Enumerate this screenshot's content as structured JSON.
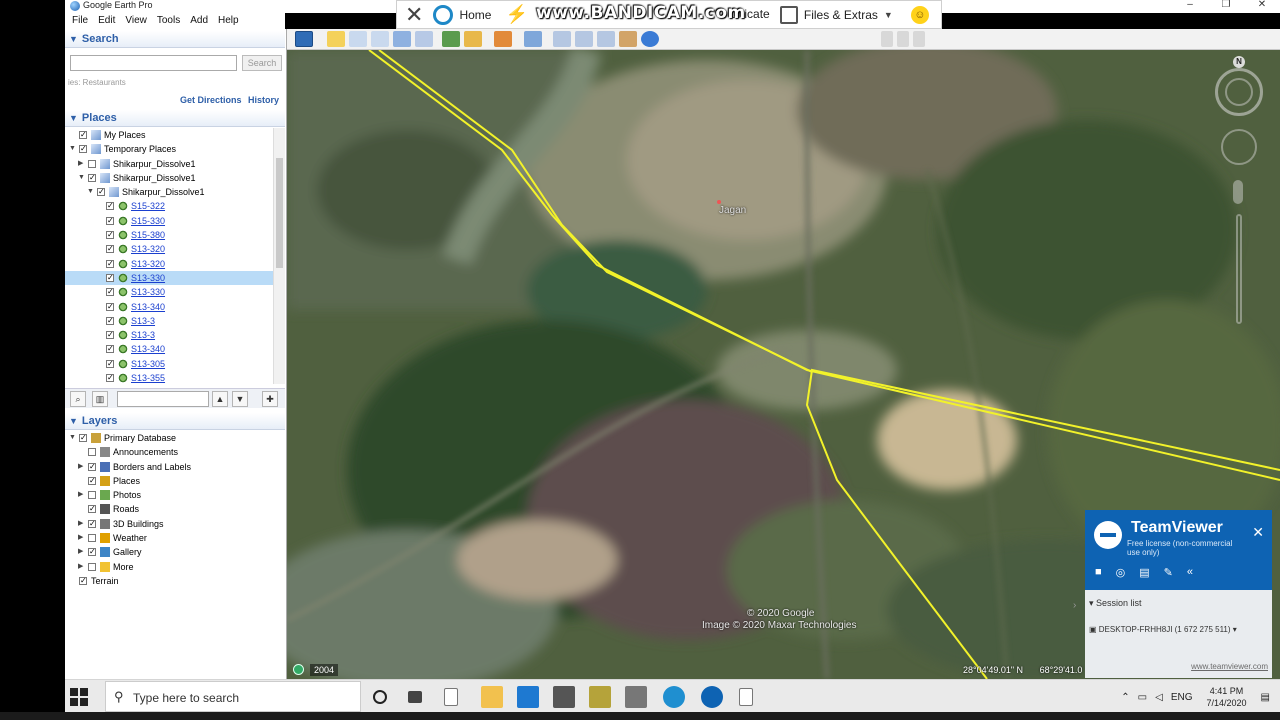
{
  "window": {
    "title": "Google Earth Pro",
    "controls": [
      "–",
      "❐",
      "✕"
    ]
  },
  "menubar": [
    "File",
    "Edit",
    "View",
    "Tools",
    "Add",
    "Help"
  ],
  "teamviewer_toolbar": {
    "home": "Home",
    "communicate": "unicate",
    "files": "Files & Extras"
  },
  "watermark": "www.BANDICAM.com",
  "search": {
    "title": "Search",
    "placeholder": "",
    "button": "Search",
    "hint": "ies: Restaurants",
    "get_directions": "Get Directions",
    "history": "History"
  },
  "places": {
    "title": "Places",
    "items": [
      {
        "label": "My Places",
        "indent": 0,
        "checked": true,
        "expander": "",
        "link": false
      },
      {
        "label": "Temporary Places",
        "indent": 0,
        "checked": true,
        "expander": "▼",
        "link": false
      },
      {
        "label": "Shikarpur_Dissolve1",
        "indent": 1,
        "checked": false,
        "expander": "▶",
        "link": false
      },
      {
        "label": "Shikarpur_Dissolve1",
        "indent": 1,
        "checked": true,
        "expander": "▼",
        "link": false
      },
      {
        "label": "Shikarpur_Dissolve1",
        "indent": 2,
        "checked": true,
        "expander": "▼",
        "link": false
      },
      {
        "label": "S15-322",
        "indent": 3,
        "checked": true,
        "expander": "",
        "link": true
      },
      {
        "label": "S15-330",
        "indent": 3,
        "checked": true,
        "expander": "",
        "link": true
      },
      {
        "label": "S15-380",
        "indent": 3,
        "checked": true,
        "expander": "",
        "link": true
      },
      {
        "label": "S13-320",
        "indent": 3,
        "checked": true,
        "expander": "",
        "link": true
      },
      {
        "label": "S13-320",
        "indent": 3,
        "checked": true,
        "expander": "",
        "link": true
      },
      {
        "label": "S13-330",
        "indent": 3,
        "checked": true,
        "expander": "",
        "link": true,
        "selected": true
      },
      {
        "label": "S13-330",
        "indent": 3,
        "checked": true,
        "expander": "",
        "link": true
      },
      {
        "label": "S13-340",
        "indent": 3,
        "checked": true,
        "expander": "",
        "link": true
      },
      {
        "label": "S13-3",
        "indent": 3,
        "checked": true,
        "expander": "",
        "link": true
      },
      {
        "label": "S13-3",
        "indent": 3,
        "checked": true,
        "expander": "",
        "link": true
      },
      {
        "label": "S13-340",
        "indent": 3,
        "checked": true,
        "expander": "",
        "link": true
      },
      {
        "label": "S13-305",
        "indent": 3,
        "checked": true,
        "expander": "",
        "link": true
      },
      {
        "label": "S13-355",
        "indent": 3,
        "checked": true,
        "expander": "",
        "link": true
      }
    ]
  },
  "layers": {
    "title": "Layers",
    "items": [
      {
        "label": "Primary Database",
        "indent": 0,
        "checked": true,
        "expander": "▼",
        "color": "#c9a13a"
      },
      {
        "label": "Announcements",
        "indent": 1,
        "checked": false,
        "expander": "",
        "color": "#888888"
      },
      {
        "label": "Borders and Labels",
        "indent": 1,
        "checked": true,
        "expander": "▶",
        "color": "#4a6fb5"
      },
      {
        "label": "Places",
        "indent": 1,
        "checked": true,
        "expander": "",
        "color": "#d4a017"
      },
      {
        "label": "Photos",
        "indent": 1,
        "checked": false,
        "expander": "▶",
        "color": "#6aa84f"
      },
      {
        "label": "Roads",
        "indent": 1,
        "checked": true,
        "expander": "",
        "color": "#555555"
      },
      {
        "label": "3D Buildings",
        "indent": 1,
        "checked": true,
        "expander": "▶",
        "color": "#777777"
      },
      {
        "label": "Weather",
        "indent": 1,
        "checked": false,
        "expander": "▶",
        "color": "#e0a000"
      },
      {
        "label": "Gallery",
        "indent": 1,
        "checked": true,
        "expander": "▶",
        "color": "#3d85c6"
      },
      {
        "label": "More",
        "indent": 1,
        "checked": false,
        "expander": "▶",
        "color": "#f1c232"
      },
      {
        "label": "Terrain",
        "indent": 0,
        "checked": true,
        "expander": "",
        "color": ""
      }
    ]
  },
  "map": {
    "place_label": "Jagan",
    "copyright_1": "© 2020 Google",
    "copyright_2": "Image © 2020 Maxar Technologies",
    "year": "2004",
    "lat": "28°04'49.01\" N",
    "lon": "68°29'41.0",
    "north_label": "N",
    "boundary_color": "#f2f22a"
  },
  "teamviewer_popup": {
    "name": "TeamViewer",
    "subtitle": "Free license (non-commercial use only)",
    "close": "✕",
    "session_list": "Session list",
    "session_device": "DESKTOP-FRHH8JI (1 672 275 511)",
    "url": "www.teamviewer.com"
  },
  "taskbar": {
    "search_placeholder": "Type here to search",
    "lang": "ENG",
    "time": "4:41 PM",
    "date": "7/14/2020"
  }
}
